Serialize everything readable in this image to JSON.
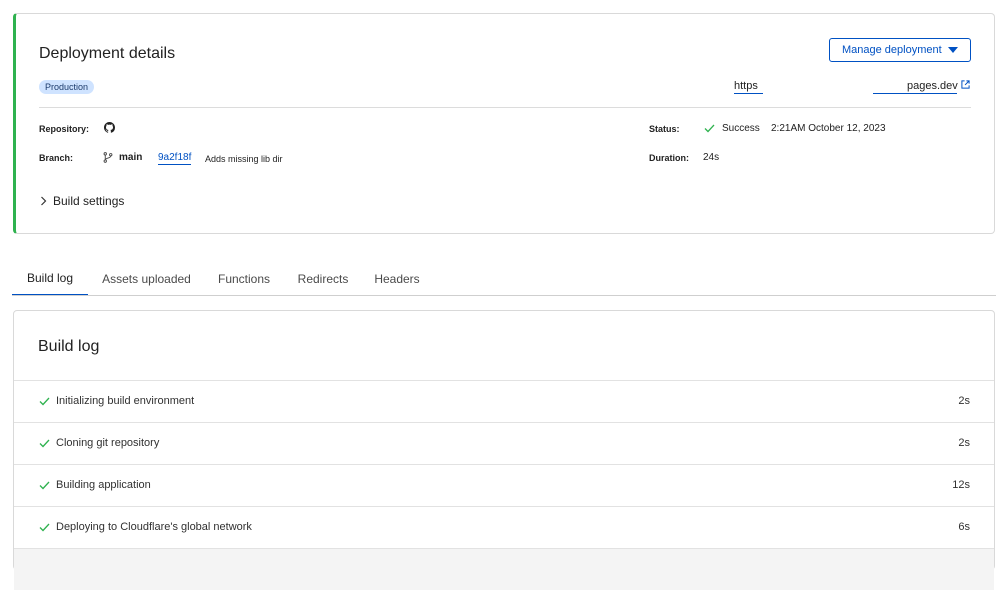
{
  "deployment": {
    "title": "Deployment details",
    "manage_label": "Manage deployment",
    "environment_badge": "Production",
    "url_start": "https",
    "url_end": "pages.dev",
    "repository_label": "Repository:",
    "branch_label": "Branch:",
    "branch_name": "main",
    "commit_hash": "9a2f18f",
    "commit_message": "Adds missing lib dir",
    "status_label": "Status:",
    "status_value": "Success",
    "status_time": "2:21AM October 12, 2023",
    "duration_label": "Duration:",
    "duration_value": "24s",
    "build_settings_label": "Build settings"
  },
  "tabs": [
    {
      "label": "Build log",
      "active": true
    },
    {
      "label": "Assets uploaded",
      "active": false
    },
    {
      "label": "Functions",
      "active": false
    },
    {
      "label": "Redirects",
      "active": false
    },
    {
      "label": "Headers",
      "active": false
    }
  ],
  "build_log": {
    "title": "Build log",
    "steps": [
      {
        "label": "Initializing build environment",
        "duration": "2s"
      },
      {
        "label": "Cloning git repository",
        "duration": "2s"
      },
      {
        "label": "Building application",
        "duration": "12s"
      },
      {
        "label": "Deploying to Cloudflare's global network",
        "duration": "6s"
      }
    ]
  },
  "colors": {
    "accent": "#0051c3",
    "success": "#2fb24f",
    "badge_bg": "#cfe3ff"
  },
  "icons": [
    "github-icon",
    "branch-icon",
    "check-icon",
    "external-link-icon",
    "chevron-right-icon",
    "caret-down-icon"
  ]
}
